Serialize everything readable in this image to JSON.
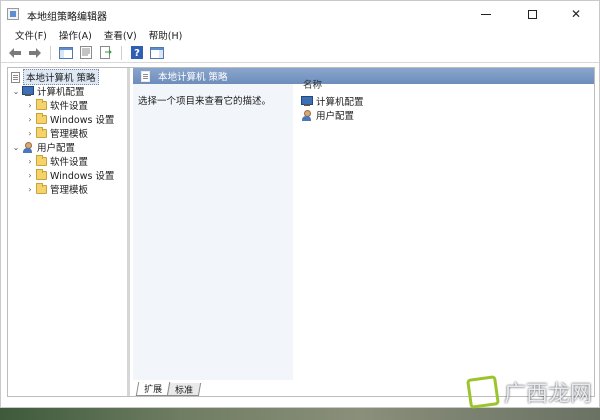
{
  "window": {
    "title": "本地组策略编辑器"
  },
  "menu": {
    "items": [
      {
        "label": "文件(F)"
      },
      {
        "label": "操作(A)"
      },
      {
        "label": "查看(V)"
      },
      {
        "label": "帮助(H)"
      }
    ]
  },
  "toolbar": {
    "buttons": [
      "back-arrow-icon",
      "forward-arrow-icon",
      "show-hide-tree-icon",
      "properties-icon",
      "export-list-icon",
      "help-icon",
      "show-hide-action-pane-icon"
    ]
  },
  "tree": {
    "root": "本地计算机 策略",
    "computer": "计算机配置",
    "computer_children": [
      "软件设置",
      "Windows 设置",
      "管理模板"
    ],
    "user": "用户配置",
    "user_children": [
      "软件设置",
      "Windows 设置",
      "管理模板"
    ]
  },
  "detail": {
    "header": "本地计算机 策略",
    "description": "选择一个项目来查看它的描述。",
    "column_name": "名称",
    "items": [
      "计算机配置",
      "用户配置"
    ]
  },
  "tabs": {
    "items": [
      "扩展",
      "标准"
    ],
    "active_index": 0
  },
  "watermark": {
    "text": "广西龙网"
  },
  "colors": {
    "header_blue": "#7996c3",
    "desc_bg": "#f2f5fa",
    "folder_yellow": "#f5d36a"
  }
}
